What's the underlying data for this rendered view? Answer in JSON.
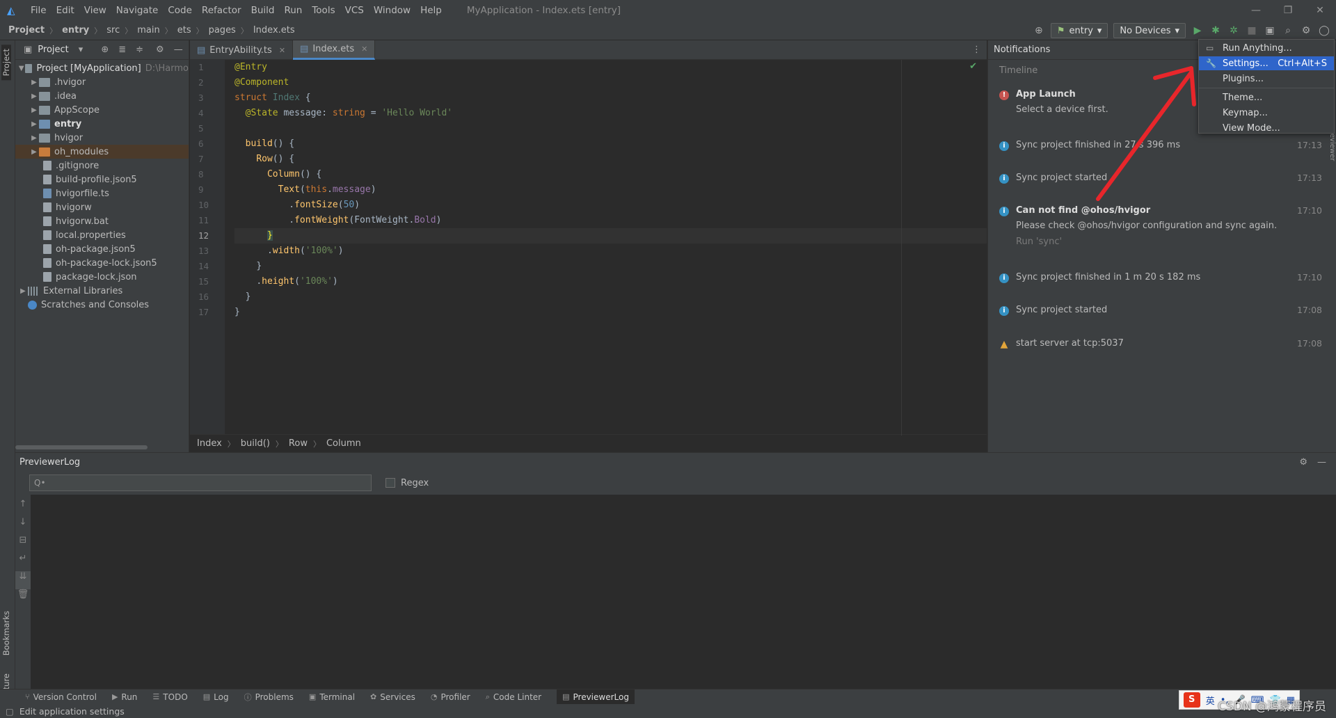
{
  "menubar": {
    "items": [
      "File",
      "Edit",
      "View",
      "Navigate",
      "Code",
      "Refactor",
      "Build",
      "Run",
      "Tools",
      "VCS",
      "Window",
      "Help"
    ],
    "title": "MyApplication - Index.ets [entry]"
  },
  "navbar": {
    "crumbs": [
      "Project",
      "entry",
      "src",
      "main",
      "ets",
      "pages",
      "Index.ets"
    ],
    "run_config": "entry",
    "device": "No Devices"
  },
  "project": {
    "header": "Project",
    "root_name": "Project [MyApplication]",
    "root_path": "D:\\Harmo",
    "items": [
      ".hvigor",
      ".idea",
      "AppScope",
      "entry",
      "hvigor",
      "oh_modules",
      ".gitignore",
      "build-profile.json5",
      "hvigorfile.ts",
      "hvigorw",
      "hvigorw.bat",
      "local.properties",
      "oh-package.json5",
      "oh-package-lock.json5",
      "package-lock.json",
      "External Libraries",
      "Scratches and Consoles"
    ]
  },
  "tabs": [
    "EntryAbility.ts",
    "Index.ets"
  ],
  "code_lines": [
    "1",
    "2",
    "3",
    "4",
    "5",
    "6",
    "7",
    "8",
    "9",
    "10",
    "11",
    "12",
    "13",
    "14",
    "15",
    "16",
    "17"
  ],
  "editor_breadcrumb": [
    "Index",
    "build()",
    "Row",
    "Column"
  ],
  "notifications": {
    "header": "Notifications",
    "timeline": "Timeline",
    "items": [
      {
        "title": "App Launch",
        "body": "Select a device first.",
        "time": ""
      },
      {
        "title": "Sync project finished in 27 s 396 ms",
        "time": "17:13"
      },
      {
        "title": "Sync project started",
        "time": "17:13"
      },
      {
        "title": "Can not find @ohos/hvigor",
        "body": "Please check @ohos/hvigor configuration and sync again.",
        "action": "Run 'sync'",
        "time": "17:10"
      },
      {
        "title": "Sync project finished in 1 m 20 s 182 ms",
        "time": "17:10"
      },
      {
        "title": "Sync project started",
        "time": "17:08"
      },
      {
        "title": "start server at tcp:5037",
        "time": "17:08"
      }
    ],
    "side_tab": "reviewer"
  },
  "context_menu": {
    "items": [
      {
        "label": "Run Anything...",
        "shortcut": ""
      },
      {
        "label": "Settings...",
        "shortcut": "Ctrl+Alt+S"
      },
      {
        "label": "Plugins...",
        "shortcut": ""
      },
      {
        "label": "Theme...",
        "shortcut": ""
      },
      {
        "label": "Keymap...",
        "shortcut": ""
      },
      {
        "label": "View Mode...",
        "shortcut": ""
      }
    ]
  },
  "log": {
    "title": "PreviewerLog",
    "search_placeholder": "Q•",
    "regex_label": "Regex"
  },
  "bottom_tabs": [
    "Version Control",
    "Run",
    "TODO",
    "Log",
    "Problems",
    "Terminal",
    "Services",
    "Profiler",
    "Code Linter",
    "PreviewerLog"
  ],
  "left_tabs": [
    "Project",
    "Bookmarks",
    "Structure"
  ],
  "status": {
    "text": "Edit application settings"
  },
  "ime": {
    "lang": "英"
  },
  "watermark": "CSDN @鸿蒙程序员",
  "colors": {
    "accent": "#2f65ca",
    "error": "#c75450",
    "info": "#3592c4",
    "annotation_arrow": "#e8262b"
  }
}
